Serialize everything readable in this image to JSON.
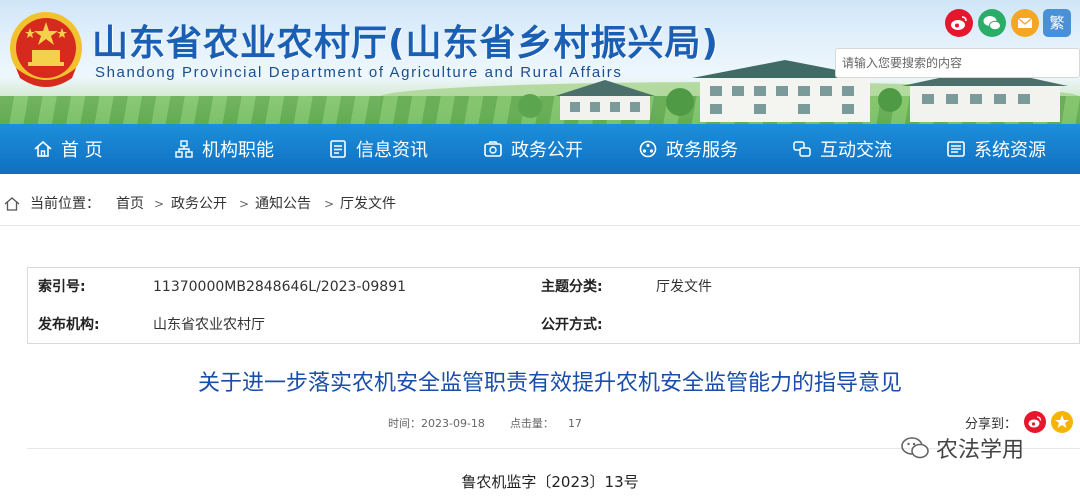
{
  "header": {
    "title_cn": "山东省农业农村厅(山东省乡村振兴局)",
    "title_en": "Shandong Provincial Department of Agriculture and Rural Affairs",
    "traditional_label": "繁",
    "search_placeholder": "请输入您要搜索的内容",
    "share_icons": [
      "weibo-icon",
      "wechat-icon",
      "mail-icon"
    ]
  },
  "nav": {
    "items": [
      {
        "label": "首 页",
        "icon": "home-icon"
      },
      {
        "label": "机构职能",
        "icon": "org-icon"
      },
      {
        "label": "信息资讯",
        "icon": "document-icon"
      },
      {
        "label": "政务公开",
        "icon": "open-gov-icon"
      },
      {
        "label": "政务服务",
        "icon": "service-icon"
      },
      {
        "label": "互动交流",
        "icon": "interaction-icon"
      },
      {
        "label": "系统资源",
        "icon": "resource-icon"
      }
    ]
  },
  "breadcrumb": {
    "prefix": "当前位置：",
    "items": [
      "首页",
      "政务公开",
      "通知公告",
      "厅发文件"
    ]
  },
  "meta": {
    "index_label": "索引号:",
    "index_value": "11370000MB2848646L/2023-09891",
    "topic_label": "主题分类:",
    "topic_value": "厅发文件",
    "publisher_label": "发布机构:",
    "publisher_value": "山东省农业农村厅",
    "open_label": "公开方式:",
    "open_value": ""
  },
  "article": {
    "title": "关于进一步落实农机安全监管职责有效提升农机安全监管能力的指导意见",
    "time_label": "时间：",
    "time_value": "2023-09-18",
    "views_label": "点击量：",
    "views_value": "17",
    "share_label": "分享到：",
    "doc_number": "鲁农机监字〔2023〕13号"
  },
  "watermark": {
    "text": "农法学用"
  },
  "colors": {
    "nav_blue": "#1378c8",
    "title_blue": "#1a5fb4",
    "article_title": "#1a4ea8",
    "weibo_red": "#e6162d",
    "wechat_green": "#2aae67"
  }
}
